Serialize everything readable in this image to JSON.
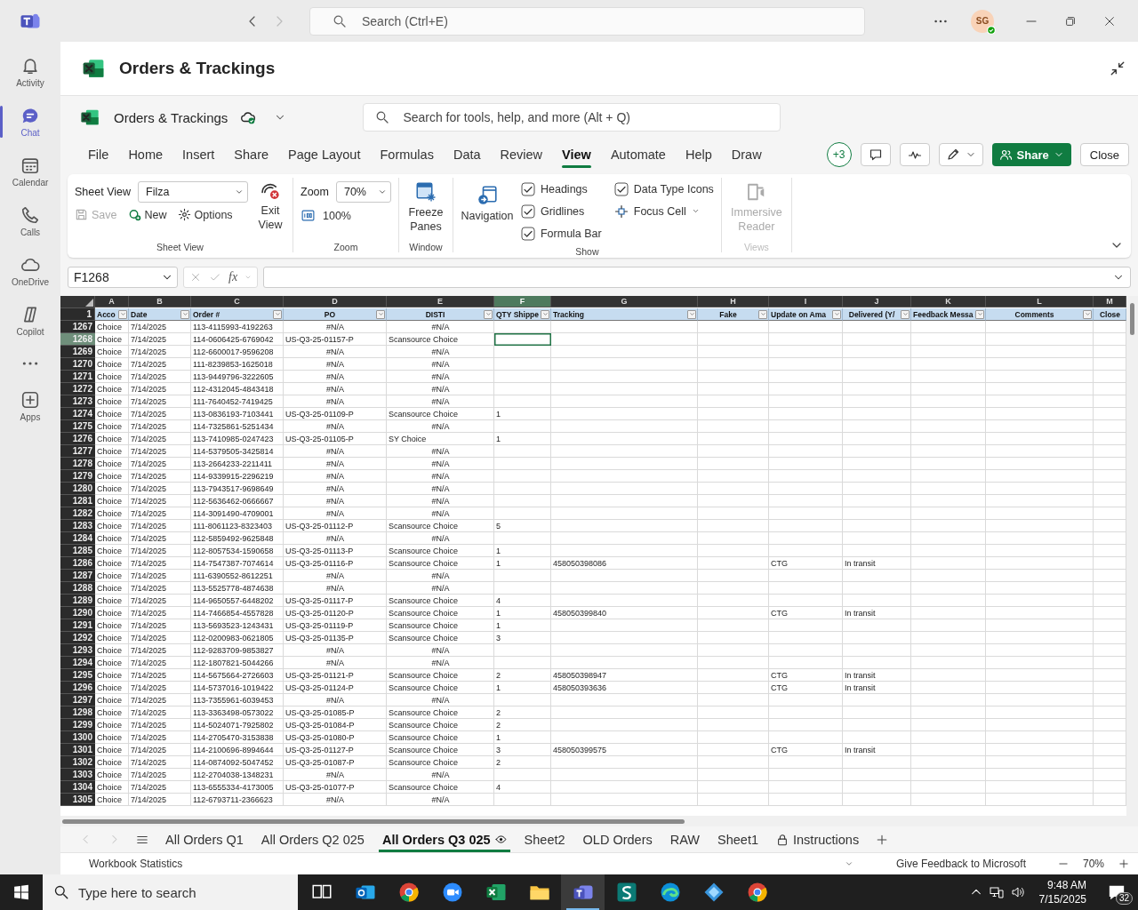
{
  "teams": {
    "search": {
      "placeholder": "Search (Ctrl+E)"
    },
    "avatar": "SG"
  },
  "rail": [
    {
      "kind": "bell",
      "label": "Activity",
      "selected": false
    },
    {
      "kind": "chat",
      "label": "Chat",
      "selected": true
    },
    {
      "kind": "calendar",
      "label": "Calendar",
      "selected": false
    },
    {
      "kind": "phone",
      "label": "Calls",
      "selected": false
    },
    {
      "kind": "cloud",
      "label": "OneDrive",
      "selected": false
    },
    {
      "kind": "copilot",
      "label": "Copilot",
      "selected": false
    },
    {
      "kind": "more",
      "selected": false
    },
    {
      "kind": "apps",
      "label": "Apps",
      "selected": false
    }
  ],
  "app_title": "Orders & Trackings",
  "workbook": {
    "name": "Orders & Trackings",
    "search": {
      "placeholder": "Search for tools, help, and more (Alt + Q)"
    }
  },
  "menu": [
    {
      "label": "File",
      "selected": false
    },
    {
      "label": "Home",
      "selected": false
    },
    {
      "label": "Insert",
      "selected": false
    },
    {
      "label": "Share",
      "selected": false
    },
    {
      "label": "Page Layout",
      "selected": false
    },
    {
      "label": "Formulas",
      "selected": false
    },
    {
      "label": "Data",
      "selected": false
    },
    {
      "label": "Review",
      "selected": false
    },
    {
      "label": "View",
      "selected": true
    },
    {
      "label": "Automate",
      "selected": false
    },
    {
      "label": "Help",
      "selected": false
    },
    {
      "label": "Draw",
      "selected": false
    }
  ],
  "toolbar": {
    "collaborators": "+3",
    "share": "Share",
    "close": "Close"
  },
  "ribbon": {
    "groups": [
      {
        "kind": "sheet_view",
        "label": "Sheet View",
        "view_label": "Sheet View",
        "view": "Filza",
        "save": {
          "label": "Save",
          "disabled": true
        },
        "new": "New",
        "options": "Options",
        "exit": "Exit View"
      },
      {
        "kind": "zoom",
        "label": "Zoom",
        "zoom_label": "Zoom",
        "zoom": "70%",
        "reset": "100%"
      },
      {
        "kind": "window",
        "label": "Window",
        "freeze": "Freeze Panes"
      },
      {
        "kind": "show",
        "label": "Show",
        "navigation": "Navigation",
        "checks": [
          {
            "label": "Headings",
            "checked": true
          },
          {
            "label": "Gridlines",
            "checked": true
          },
          {
            "label": "Formula Bar",
            "checked": true
          },
          {
            "label": "Data Type Icons",
            "checked": true
          }
        ],
        "focus": "Focus Cell"
      },
      {
        "kind": "views",
        "label": "Views",
        "disabled": true,
        "reader": "Immersive Reader"
      }
    ]
  },
  "formula_bar": {
    "name_box": "F1268",
    "function_label": "fx"
  },
  "sheet": {
    "header_row_number": "1",
    "columns": [
      {
        "letter": "A",
        "header": "Acco",
        "kind": "plain",
        "filter": true,
        "selected": false
      },
      {
        "letter": "B",
        "header": "Date",
        "kind": "plain",
        "filter": true,
        "selected": false
      },
      {
        "letter": "C",
        "header": "Order #",
        "kind": "plain",
        "filter": true,
        "selected": false
      },
      {
        "letter": "D",
        "header": "PO",
        "kind": "centered",
        "filter": true,
        "selected": false
      },
      {
        "letter": "E",
        "header": "DISTI",
        "kind": "centered",
        "filter": true,
        "selected": false
      },
      {
        "letter": "F",
        "header": "QTY Shippe",
        "kind": "plain",
        "filter": true,
        "selected": true
      },
      {
        "letter": "G",
        "header": "Tracking",
        "kind": "plain",
        "filter": true,
        "selected": false
      },
      {
        "letter": "H",
        "header": "Fake",
        "kind": "centered",
        "filter": true,
        "selected": false
      },
      {
        "letter": "I",
        "header": "Update on Ama",
        "kind": "plain",
        "filter": true,
        "selected": false
      },
      {
        "letter": "J",
        "header": "Delivered (Y/",
        "kind": "centered",
        "filter": true,
        "selected": false
      },
      {
        "letter": "K",
        "header": "Feedback Messa",
        "kind": "plain",
        "filter": true,
        "selected": false
      },
      {
        "letter": "L",
        "header": "Comments",
        "kind": "centered",
        "filter": true,
        "selected": false
      },
      {
        "letter": "M",
        "header": "Close",
        "kind": "centered",
        "filter": false,
        "selected": false
      }
    ],
    "rows": [
      {
        "number": "1267",
        "selected": false,
        "kind": "na",
        "A": "Choice",
        "B": "7/14/2025",
        "C": "113-4115993-4192263",
        "D": "#N/A",
        "E": "#N/A"
      },
      {
        "number": "1268",
        "selected": true,
        "kind": "po",
        "A": "Choice",
        "B": "7/14/2025",
        "C": "114-0606425-6769042",
        "D": "US-Q3-25-01157-P",
        "E": "Scansource Choice"
      },
      {
        "number": "1269",
        "selected": false,
        "kind": "na",
        "A": "Choice",
        "B": "7/14/2025",
        "C": "112-6600017-9596208",
        "D": "#N/A",
        "E": "#N/A"
      },
      {
        "number": "1270",
        "selected": false,
        "kind": "na",
        "A": "Choice",
        "B": "7/14/2025",
        "C": "111-8239853-1625018",
        "D": "#N/A",
        "E": "#N/A"
      },
      {
        "number": "1271",
        "selected": false,
        "kind": "na",
        "A": "Choice",
        "B": "7/14/2025",
        "C": "113-9449796-3222605",
        "D": "#N/A",
        "E": "#N/A"
      },
      {
        "number": "1272",
        "selected": false,
        "kind": "na",
        "A": "Choice",
        "B": "7/14/2025",
        "C": "112-4312045-4843418",
        "D": "#N/A",
        "E": "#N/A"
      },
      {
        "number": "1273",
        "selected": false,
        "kind": "na",
        "A": "Choice",
        "B": "7/14/2025",
        "C": "111-7640452-7419425",
        "D": "#N/A",
        "E": "#N/A"
      },
      {
        "number": "1274",
        "selected": false,
        "kind": "po",
        "A": "Choice",
        "B": "7/14/2025",
        "C": "113-0836193-7103441",
        "D": "US-Q3-25-01109-P",
        "E": "Scansource Choice",
        "F": "1"
      },
      {
        "number": "1275",
        "selected": false,
        "kind": "na",
        "A": "Choice",
        "B": "7/14/2025",
        "C": "114-7325861-5251434",
        "D": "#N/A",
        "E": "#N/A"
      },
      {
        "number": "1276",
        "selected": false,
        "kind": "po",
        "A": "Choice",
        "B": "7/14/2025",
        "C": "113-7410985-0247423",
        "D": "US-Q3-25-01105-P",
        "E": "SY Choice",
        "F": "1"
      },
      {
        "number": "1277",
        "selected": false,
        "kind": "na",
        "A": "Choice",
        "B": "7/14/2025",
        "C": "114-5379505-3425814",
        "D": "#N/A",
        "E": "#N/A"
      },
      {
        "number": "1278",
        "selected": false,
        "kind": "na",
        "A": "Choice",
        "B": "7/14/2025",
        "C": "113-2664233-2211411",
        "D": "#N/A",
        "E": "#N/A"
      },
      {
        "number": "1279",
        "selected": false,
        "kind": "na",
        "A": "Choice",
        "B": "7/14/2025",
        "C": "114-9339915-2296219",
        "D": "#N/A",
        "E": "#N/A"
      },
      {
        "number": "1280",
        "selected": false,
        "kind": "na",
        "A": "Choice",
        "B": "7/14/2025",
        "C": "113-7943517-9698649",
        "D": "#N/A",
        "E": "#N/A"
      },
      {
        "number": "1281",
        "selected": false,
        "kind": "na",
        "A": "Choice",
        "B": "7/14/2025",
        "C": "112-5636462-0666667",
        "D": "#N/A",
        "E": "#N/A"
      },
      {
        "number": "1282",
        "selected": false,
        "kind": "na",
        "A": "Choice",
        "B": "7/14/2025",
        "C": "114-3091490-4709001",
        "D": "#N/A",
        "E": "#N/A"
      },
      {
        "number": "1283",
        "selected": false,
        "kind": "po",
        "A": "Choice",
        "B": "7/14/2025",
        "C": "111-8061123-8323403",
        "D": "US-Q3-25-01112-P",
        "E": "Scansource Choice",
        "F": "5"
      },
      {
        "number": "1284",
        "selected": false,
        "kind": "na",
        "A": "Choice",
        "B": "7/14/2025",
        "C": "112-5859492-9625848",
        "D": "#N/A",
        "E": "#N/A"
      },
      {
        "number": "1285",
        "selected": false,
        "kind": "po",
        "A": "Choice",
        "B": "7/14/2025",
        "C": "112-8057534-1590658",
        "D": "US-Q3-25-01113-P",
        "E": "Scansource Choice",
        "F": "1"
      },
      {
        "number": "1286",
        "selected": false,
        "kind": "po",
        "A": "Choice",
        "B": "7/14/2025",
        "C": "114-7547387-7074614",
        "D": "US-Q3-25-01116-P",
        "E": "Scansource Choice",
        "F": "1",
        "G": "458050398086",
        "I": "CTG",
        "J": "In transit"
      },
      {
        "number": "1287",
        "selected": false,
        "kind": "na",
        "A": "Choice",
        "B": "7/14/2025",
        "C": "111-6390552-8612251",
        "D": "#N/A",
        "E": "#N/A"
      },
      {
        "number": "1288",
        "selected": false,
        "kind": "na",
        "A": "Choice",
        "B": "7/14/2025",
        "C": "113-5525778-4874638",
        "D": "#N/A",
        "E": "#N/A"
      },
      {
        "number": "1289",
        "selected": false,
        "kind": "po",
        "A": "Choice",
        "B": "7/14/2025",
        "C": "114-9650557-6448202",
        "D": "US-Q3-25-01117-P",
        "E": "Scansource Choice",
        "F": "4"
      },
      {
        "number": "1290",
        "selected": false,
        "kind": "po",
        "A": "Choice",
        "B": "7/14/2025",
        "C": "114-7466854-4557828",
        "D": "US-Q3-25-01120-P",
        "E": "Scansource Choice",
        "F": "1",
        "G": "458050399840",
        "I": "CTG",
        "J": "In transit"
      },
      {
        "number": "1291",
        "selected": false,
        "kind": "po",
        "A": "Choice",
        "B": "7/14/2025",
        "C": "113-5693523-1243431",
        "D": "US-Q3-25-01119-P",
        "E": "Scansource Choice",
        "F": "1"
      },
      {
        "number": "1292",
        "selected": false,
        "kind": "po",
        "A": "Choice",
        "B": "7/14/2025",
        "C": "112-0200983-0621805",
        "D": "US-Q3-25-01135-P",
        "E": "Scansource Choice",
        "F": "3"
      },
      {
        "number": "1293",
        "selected": false,
        "kind": "na",
        "A": "Choice",
        "B": "7/14/2025",
        "C": "112-9283709-9853827",
        "D": "#N/A",
        "E": "#N/A"
      },
      {
        "number": "1294",
        "selected": false,
        "kind": "na",
        "A": "Choice",
        "B": "7/14/2025",
        "C": "112-1807821-5044266",
        "D": "#N/A",
        "E": "#N/A"
      },
      {
        "number": "1295",
        "selected": false,
        "kind": "po",
        "A": "Choice",
        "B": "7/14/2025",
        "C": "114-5675664-2726603",
        "D": "US-Q3-25-01121-P",
        "E": "Scansource Choice",
        "F": "2",
        "G": "458050398947",
        "I": "CTG",
        "J": "In transit"
      },
      {
        "number": "1296",
        "selected": false,
        "kind": "po",
        "A": "Choice",
        "B": "7/14/2025",
        "C": "114-5737016-1019422",
        "D": "US-Q3-25-01124-P",
        "E": "Scansource Choice",
        "F": "1",
        "G": "458050393636",
        "I": "CTG",
        "J": "In transit"
      },
      {
        "number": "1297",
        "selected": false,
        "kind": "na",
        "A": "Choice",
        "B": "7/14/2025",
        "C": "113-7355961-6039453",
        "D": "#N/A",
        "E": "#N/A"
      },
      {
        "number": "1298",
        "selected": false,
        "kind": "po",
        "A": "Choice",
        "B": "7/14/2025",
        "C": "113-3363498-0573022",
        "D": "US-Q3-25-01085-P",
        "E": "Scansource Choice",
        "F": "2"
      },
      {
        "number": "1299",
        "selected": false,
        "kind": "po",
        "A": "Choice",
        "B": "7/14/2025",
        "C": "114-5024071-7925802",
        "D": "US-Q3-25-01084-P",
        "E": "Scansource Choice",
        "F": "2"
      },
      {
        "number": "1300",
        "selected": false,
        "kind": "po",
        "A": "Choice",
        "B": "7/14/2025",
        "C": "114-2705470-3153838",
        "D": "US-Q3-25-01080-P",
        "E": "Scansource Choice",
        "F": "1"
      },
      {
        "number": "1301",
        "selected": false,
        "kind": "po",
        "A": "Choice",
        "B": "7/14/2025",
        "C": "114-2100696-8994644",
        "D": "US-Q3-25-01127-P",
        "E": "Scansource Choice",
        "F": "3",
        "G": "458050399575",
        "I": "CTG",
        "J": "In transit"
      },
      {
        "number": "1302",
        "selected": false,
        "kind": "po",
        "A": "Choice",
        "B": "7/14/2025",
        "C": "114-0874092-5047452",
        "D": "US-Q3-25-01087-P",
        "E": "Scansource Choice",
        "F": "2"
      },
      {
        "number": "1303",
        "selected": false,
        "kind": "na",
        "A": "Choice",
        "B": "7/14/2025",
        "C": "112-2704038-1348231",
        "D": "#N/A",
        "E": "#N/A"
      },
      {
        "number": "1304",
        "selected": false,
        "kind": "po",
        "A": "Choice",
        "B": "7/14/2025",
        "C": "113-6555334-4173005",
        "D": "US-Q3-25-01077-P",
        "E": "Scansource Choice",
        "F": "4"
      },
      {
        "number": "1305",
        "selected": false,
        "kind": "na",
        "A": "Choice",
        "B": "7/14/2025",
        "C": "112-6793711-2366623",
        "D": "#N/A",
        "E": "#N/A"
      }
    ]
  },
  "sheet_tabs": [
    {
      "label": "All Orders Q1",
      "kind": "plain",
      "selected": false
    },
    {
      "label": "All Orders Q2 025",
      "kind": "plain",
      "selected": false
    },
    {
      "label": "All Orders Q3 025",
      "kind": "eye",
      "selected": true
    },
    {
      "label": "Sheet2",
      "kind": "plain",
      "selected": false
    },
    {
      "label": "OLD Orders",
      "kind": "plain",
      "selected": false
    },
    {
      "label": "RAW",
      "kind": "plain",
      "selected": false
    },
    {
      "label": "Sheet1",
      "kind": "plain",
      "selected": false
    },
    {
      "label": "Instructions",
      "kind": "lock",
      "selected": false
    }
  ],
  "status_bar": {
    "statistics": "Workbook Statistics",
    "feedback": "Give Feedback to Microsoft",
    "zoom": "70%"
  },
  "taskbar": {
    "search": {
      "placeholder": "Type here to search"
    },
    "apps": [
      {
        "kind": "taskview",
        "selected": false
      },
      {
        "kind": "mail",
        "selected": false
      },
      {
        "kind": "browser",
        "selected": false
      },
      {
        "kind": "video",
        "selected": false
      },
      {
        "kind": "sheet",
        "selected": false
      },
      {
        "kind": "folder",
        "selected": false
      },
      {
        "kind": "team",
        "selected": true
      },
      {
        "kind": "curve",
        "selected": false
      },
      {
        "kind": "wave",
        "selected": false
      },
      {
        "kind": "diamond",
        "selected": false
      },
      {
        "kind": "browser",
        "selected": false
      }
    ],
    "time": "9:48 AM",
    "date": "7/15/2025",
    "notifications": "32"
  }
}
